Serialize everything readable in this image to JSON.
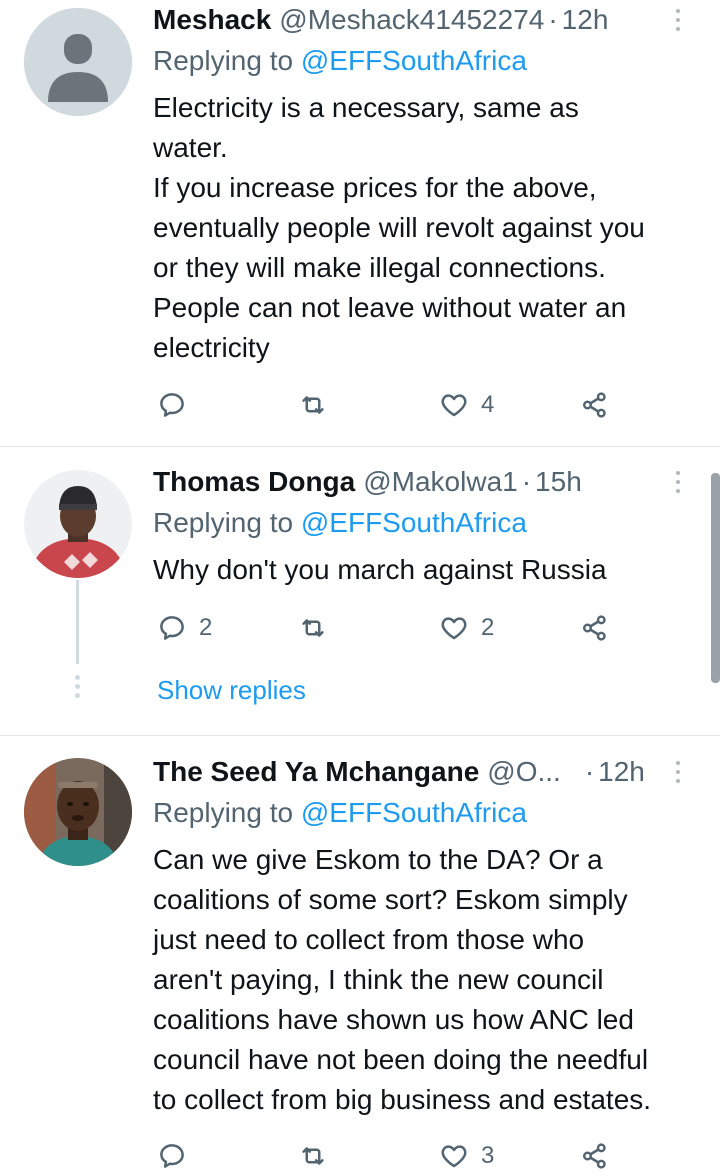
{
  "tweets": [
    {
      "name": "Meshack",
      "handle": "@Meshack41452274",
      "dot": "·",
      "time": "12h",
      "replying_prefix": "Replying to",
      "replying_handle": "@EFFSouthAfrica",
      "lines": [
        "Electricity is a necessary, same as",
        "water.",
        "If you increase prices for the above,",
        "eventually people will revolt against you",
        "or they will make illegal connections.",
        "People can not leave without water an",
        "electricity"
      ],
      "reply_count": "",
      "retweet_count": "",
      "like_count": "4",
      "avatar": "default-avatar"
    },
    {
      "name": "Thomas Donga",
      "handle": "@Makolwa1",
      "dot": "·",
      "time": "15h",
      "replying_prefix": "Replying to",
      "replying_handle": "@EFFSouthAfrica",
      "lines": [
        "Why don't you march against Russia"
      ],
      "reply_count": "2",
      "retweet_count": "",
      "like_count": "2",
      "show_replies": "Show replies",
      "avatar": "photo-avatar"
    },
    {
      "name": "The Seed Ya Mchangane",
      "handle": "@O...",
      "dot": "·",
      "time": "12h",
      "replying_prefix": "Replying to",
      "replying_handle": "@EFFSouthAfrica",
      "lines": [
        "Can we give Eskom to the DA? Or a",
        "coalitions of some sort? Eskom simply",
        "just need to collect from those who",
        "aren't paying, I think the new council",
        "coalitions have shown us how ANC led",
        "council have not been doing the needful",
        "to collect from big business and estates."
      ],
      "reply_count": "",
      "retweet_count": "",
      "like_count": "3",
      "avatar": "photo-avatar"
    }
  ],
  "icons": {
    "reply": "reply-icon",
    "retweet": "retweet-icon",
    "like": "heart-icon",
    "share": "share-icon",
    "more": "more-options-icon"
  },
  "colors": {
    "accent": "#1d9bf0",
    "secondary_text": "#536471",
    "divider": "#e2e6ea"
  }
}
